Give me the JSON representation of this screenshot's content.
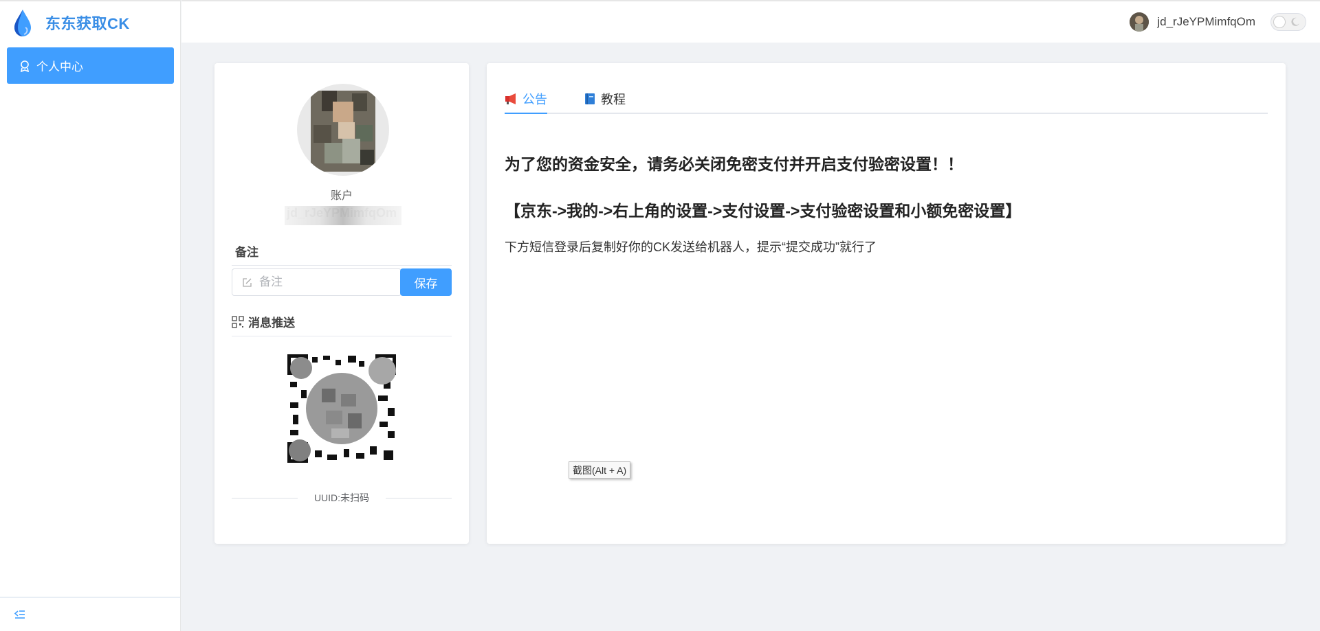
{
  "brand": {
    "title": "东东获取CK",
    "logo_icon": "water-drop-icon",
    "color": "#3a8ee6"
  },
  "sidebar": {
    "items": [
      {
        "label": "个人中心",
        "icon": "user-center-icon",
        "active": true
      }
    ],
    "collapse_icon": "menu-fold-icon"
  },
  "header": {
    "username": "jd_rJeYPMimfqOm",
    "theme_toggle_icon": "moon-icon"
  },
  "profile": {
    "account_label": "账户",
    "account_value": "jd_rJeYPMimfqOm",
    "remark_title": "备注",
    "remark_placeholder": "备注",
    "save_label": "保存",
    "push_title": "消息推送",
    "uuid_text": "UUID:未扫码"
  },
  "notice": {
    "tabs": [
      {
        "label": "公告",
        "icon": "megaphone-icon",
        "active": true
      },
      {
        "label": "教程",
        "icon": "book-icon",
        "active": false
      }
    ],
    "line1": "为了您的资金安全，请务必关闭免密支付并开启支付验密设置！！",
    "line2": "【京东->我的->右上角的设置->支付设置->支付验密设置和小额免密设置】",
    "line3": "下方短信登录后复制好你的CK发送给机器人，提示“提交成功”就行了"
  },
  "tooltip": {
    "text": "截图(Alt + A)"
  },
  "colors": {
    "primary": "#409eff",
    "background": "#f0f2f5"
  }
}
